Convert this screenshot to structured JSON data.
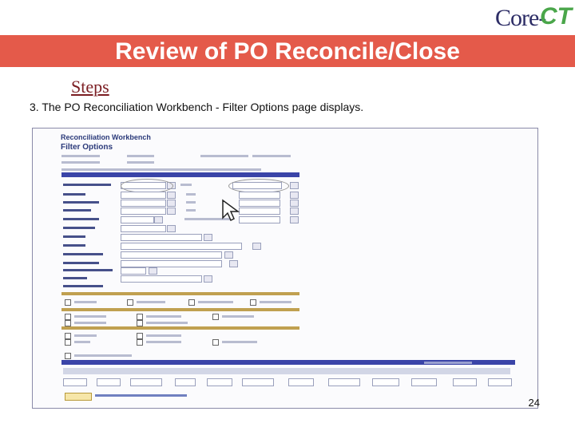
{
  "logo": {
    "core": "Core-",
    "ct": "CT"
  },
  "banner": {
    "title": "Review of PO Reconcile/Close"
  },
  "steps_label": "Steps",
  "caption": "3. The PO Reconciliation Workbench - Filter Options page displays.",
  "screenshot": {
    "title": "Reconciliation Workbench",
    "subtitle": "Filter Options"
  },
  "page_number": "24",
  "colors": {
    "banner": "#e45a4a",
    "steps": "#7b1d22",
    "screenshot_bar": "#3a44a8",
    "screenshot_gold_bar": "#c0a050"
  }
}
